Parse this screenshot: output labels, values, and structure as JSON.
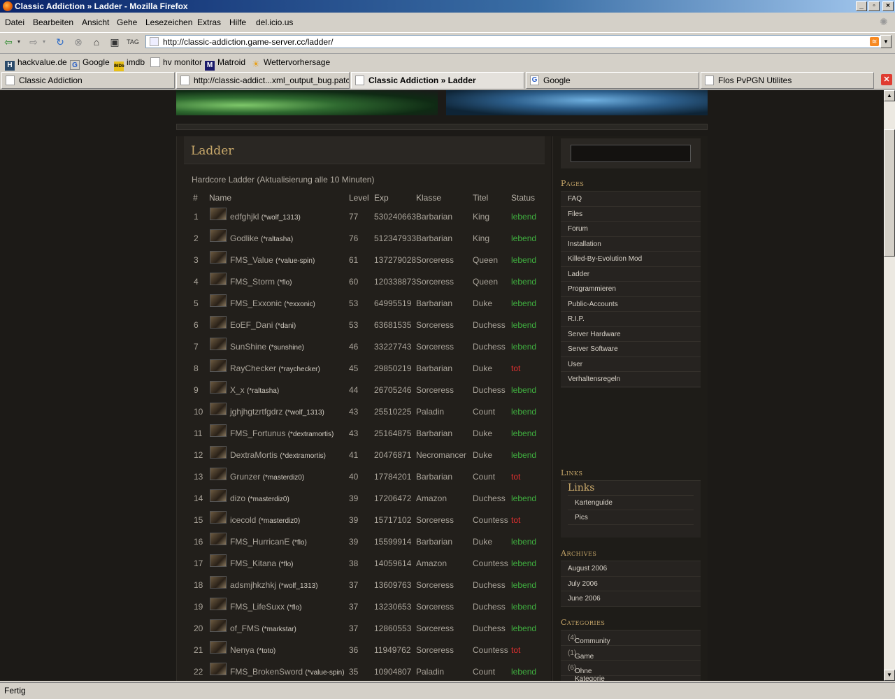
{
  "window": {
    "title": "Classic Addiction » Ladder - Mozilla Firefox"
  },
  "menu": [
    "Datei",
    "Bearbeiten",
    "Ansicht",
    "Gehe",
    "Lesezeichen",
    "Extras",
    "Hilfe",
    "del.icio.us"
  ],
  "address": {
    "url": "http://classic-addiction.game-server.cc/ladder/"
  },
  "bookmarks": [
    "hackvalue.de",
    "Google",
    "imdb",
    "hv monitor",
    "Matroid",
    "Wettervorhersage"
  ],
  "tabs": [
    "Classic Addiction",
    "http://classic-addict...xml_output_bug.patch",
    "Classic Addiction » Ladder",
    "Google",
    "Flos PvPGN Utilites"
  ],
  "status": "Fertig",
  "page": {
    "title": "Ladder",
    "subtitle": "Hardcore Ladder (Aktualisierung alle 10 Minuten)",
    "columns": [
      "#",
      "Name",
      "Level",
      "Exp",
      "Klasse",
      "Titel",
      "Status"
    ],
    "rows": [
      {
        "rank": "1",
        "name": "edfghjkl",
        "acct": "(*wolf_1313)",
        "level": "77",
        "exp": "530240663",
        "klasse": "Barbarian",
        "titel": "King",
        "status": "lebend"
      },
      {
        "rank": "2",
        "name": "Godlike",
        "acct": "(*raltasha)",
        "level": "76",
        "exp": "512347933",
        "klasse": "Barbarian",
        "titel": "King",
        "status": "lebend"
      },
      {
        "rank": "3",
        "name": "FMS_Value",
        "acct": "(*value-spin)",
        "level": "61",
        "exp": "137279028",
        "klasse": "Sorceress",
        "titel": "Queen",
        "status": "lebend"
      },
      {
        "rank": "4",
        "name": "FMS_Storm",
        "acct": "(*flo)",
        "level": "60",
        "exp": "120338873",
        "klasse": "Sorceress",
        "titel": "Queen",
        "status": "lebend"
      },
      {
        "rank": "5",
        "name": "FMS_Exxonic",
        "acct": "(*exxonic)",
        "level": "53",
        "exp": "64995519",
        "klasse": "Barbarian",
        "titel": "Duke",
        "status": "lebend"
      },
      {
        "rank": "6",
        "name": "EoEF_Dani",
        "acct": "(*dani)",
        "level": "53",
        "exp": "63681535",
        "klasse": "Sorceress",
        "titel": "Duchess",
        "status": "lebend"
      },
      {
        "rank": "7",
        "name": "SunShine",
        "acct": "(*sunshine)",
        "level": "46",
        "exp": "33227743",
        "klasse": "Sorceress",
        "titel": "Duchess",
        "status": "lebend"
      },
      {
        "rank": "8",
        "name": "RayChecker",
        "acct": "(*raychecker)",
        "level": "45",
        "exp": "29850219",
        "klasse": "Barbarian",
        "titel": "Duke",
        "status": "tot"
      },
      {
        "rank": "9",
        "name": "X_x",
        "acct": "(*raltasha)",
        "level": "44",
        "exp": "26705246",
        "klasse": "Sorceress",
        "titel": "Duchess",
        "status": "lebend"
      },
      {
        "rank": "10",
        "name": "jghjhgtzrtfgdrz",
        "acct": "(*wolf_1313)",
        "level": "43",
        "exp": "25510225",
        "klasse": "Paladin",
        "titel": "Count",
        "status": "lebend"
      },
      {
        "rank": "11",
        "name": "FMS_Fortunus",
        "acct": "(*dextramortis)",
        "level": "43",
        "exp": "25164875",
        "klasse": "Barbarian",
        "titel": "Duke",
        "status": "lebend"
      },
      {
        "rank": "12",
        "name": "DextraMortis",
        "acct": "(*dextramortis)",
        "level": "41",
        "exp": "20476871",
        "klasse": "Necromancer",
        "titel": "Duke",
        "status": "lebend"
      },
      {
        "rank": "13",
        "name": "Grunzer",
        "acct": "(*masterdiz0)",
        "level": "40",
        "exp": "17784201",
        "klasse": "Barbarian",
        "titel": "Count",
        "status": "tot"
      },
      {
        "rank": "14",
        "name": "dizo",
        "acct": "(*masterdiz0)",
        "level": "39",
        "exp": "17206472",
        "klasse": "Amazon",
        "titel": "Duchess",
        "status": "lebend"
      },
      {
        "rank": "15",
        "name": "icecold",
        "acct": "(*masterdiz0)",
        "level": "39",
        "exp": "15717102",
        "klasse": "Sorceress",
        "titel": "Countess",
        "status": "tot"
      },
      {
        "rank": "16",
        "name": "FMS_HurricanE",
        "acct": "(*flo)",
        "level": "39",
        "exp": "15599914",
        "klasse": "Barbarian",
        "titel": "Duke",
        "status": "lebend"
      },
      {
        "rank": "17",
        "name": "FMS_Kitana",
        "acct": "(*flo)",
        "level": "38",
        "exp": "14059614",
        "klasse": "Amazon",
        "titel": "Countess",
        "status": "lebend"
      },
      {
        "rank": "18",
        "name": "adsmjhkzhkj",
        "acct": "(*wolf_1313)",
        "level": "37",
        "exp": "13609763",
        "klasse": "Sorceress",
        "titel": "Duchess",
        "status": "lebend"
      },
      {
        "rank": "19",
        "name": "FMS_LifeSuxx",
        "acct": "(*flo)",
        "level": "37",
        "exp": "13230653",
        "klasse": "Sorceress",
        "titel": "Duchess",
        "status": "lebend"
      },
      {
        "rank": "20",
        "name": "of_FMS",
        "acct": "(*markstar)",
        "level": "37",
        "exp": "12860553",
        "klasse": "Sorceress",
        "titel": "Duchess",
        "status": "lebend"
      },
      {
        "rank": "21",
        "name": "Nenya",
        "acct": "(*toto)",
        "level": "36",
        "exp": "11949762",
        "klasse": "Sorceress",
        "titel": "Countess",
        "status": "tot"
      },
      {
        "rank": "22",
        "name": "FMS_BrokenSword",
        "acct": "(*value-spin)",
        "level": "35",
        "exp": "10904807",
        "klasse": "Paladin",
        "titel": "Count",
        "status": "lebend"
      }
    ]
  },
  "sidebar": {
    "pages_heading": "Pages",
    "pages": [
      "FAQ",
      "Files",
      "Forum",
      "Installation",
      "Killed-By-Evolution Mod",
      "Ladder",
      "Programmieren",
      "Public-Accounts",
      "R.I.P.",
      "Server Hardware",
      "Server Software",
      "User",
      "Verhaltensregeln"
    ],
    "links_heading": "Links",
    "links_title": "Links",
    "links": [
      "Kartenguide",
      "Pics"
    ],
    "archives_heading": "Archives",
    "archives": [
      "August 2006",
      "July 2006",
      "June 2006"
    ],
    "categories_heading": "Categories",
    "categories": [
      {
        "name": "Community",
        "count": "(4)"
      },
      {
        "name": "Game",
        "count": "(1)"
      },
      {
        "name": "Ohne Kategorie",
        "count": "(6)"
      }
    ]
  }
}
